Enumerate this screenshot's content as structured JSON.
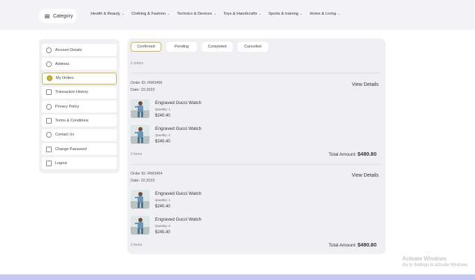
{
  "header": {
    "category_label": "Category",
    "nav": [
      {
        "label": "Health & Beauty"
      },
      {
        "label": "Clothing & Fashion"
      },
      {
        "label": "Technics & Devices"
      },
      {
        "label": "Toys & Handicrafts"
      },
      {
        "label": "Sports & training"
      },
      {
        "label": "Home & Living"
      }
    ]
  },
  "sidebar": {
    "items": [
      {
        "label": "Account Details",
        "icon": "user-icon"
      },
      {
        "label": "Address",
        "icon": "location-pin-icon"
      },
      {
        "label": "My Orders",
        "icon": "orders-icon",
        "active": true
      },
      {
        "label": "Transaction History",
        "icon": "transaction-icon"
      },
      {
        "label": "Privacy Policy",
        "icon": "shield-icon"
      },
      {
        "label": "Terms & Conditions",
        "icon": "document-icon"
      },
      {
        "label": "Contact Us",
        "icon": "headset-icon"
      },
      {
        "label": "Change Password",
        "icon": "lock-icon"
      },
      {
        "label": "Logout",
        "icon": "logout-icon"
      }
    ]
  },
  "orders": {
    "tabs": [
      "Confirmed",
      "Pending",
      "Completed",
      "Cancelled"
    ],
    "active_tab": "Confirmed",
    "count_text": "2 orders",
    "list": [
      {
        "id_label": "Order ID:",
        "id": "RW3456",
        "date_label": "Date:",
        "date": "22,2022",
        "view_details": "View Details",
        "products": [
          {
            "name": "Engraved Gucci Watch",
            "qty": "Quantity: 1",
            "price": "$240.40"
          },
          {
            "name": "Engraved Gucci Watch",
            "qty": "Quantity: 2",
            "price": "$240.40"
          }
        ],
        "items_text": "2 items",
        "total_label": "Total Amount:",
        "total": "$480.80"
      },
      {
        "id_label": "Order ID:",
        "id": "RW3454",
        "date_label": "Date:",
        "date": "22,2022",
        "view_details": "View Details",
        "products": [
          {
            "name": "Engraved Gucci Watch",
            "qty": "Quantity: 1",
            "price": "$240.40"
          },
          {
            "name": "Engraved Gucci Watch",
            "qty": "Quantity: 2",
            "price": "$240.40"
          }
        ],
        "items_text": "2 items",
        "total_label": "Total Amount:",
        "total": "$480.80"
      }
    ]
  },
  "watermark": {
    "line1": "Activate Windows",
    "line2": "Go to Settings to activate Windows."
  },
  "colors": {
    "accent": "#c9b640",
    "panel_bg": "#f0eff4",
    "header_bg": "#f4f3f7",
    "bottom_strip": "#c8c9f2"
  }
}
